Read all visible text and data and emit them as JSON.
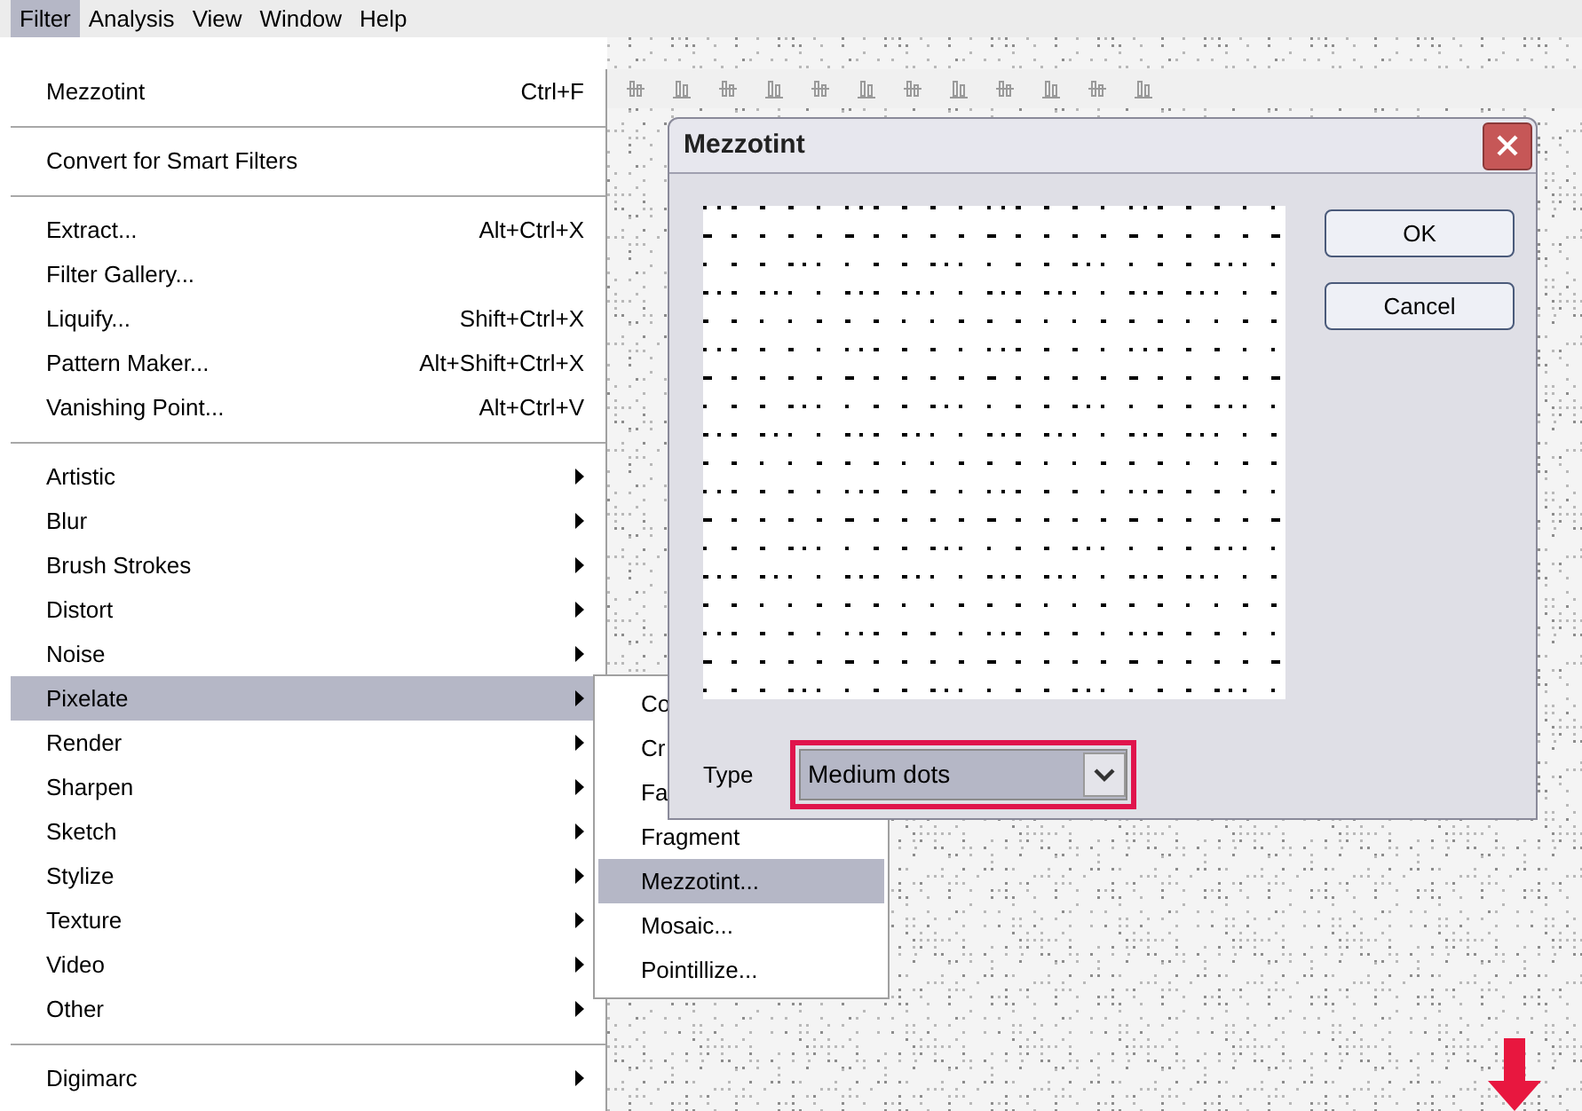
{
  "menu_bar": [
    {
      "label": "Filter",
      "selected": true
    },
    {
      "label": "Analysis",
      "selected": false
    },
    {
      "label": "View",
      "selected": false
    },
    {
      "label": "Window",
      "selected": false
    },
    {
      "label": "Help",
      "selected": false
    }
  ],
  "filter_menu": {
    "items": [
      {
        "kind": "item",
        "label": "Mezzotint",
        "shortcut": "Ctrl+F",
        "selected": false
      },
      {
        "kind": "separator"
      },
      {
        "kind": "item",
        "label": "Convert for Smart Filters",
        "selected": false
      },
      {
        "kind": "separator"
      },
      {
        "kind": "item",
        "label": "Extract...",
        "shortcut": "Alt+Ctrl+X",
        "selected": false
      },
      {
        "kind": "item",
        "label": "Filter Gallery...",
        "selected": false
      },
      {
        "kind": "item",
        "label": "Liquify...",
        "shortcut": "Shift+Ctrl+X",
        "selected": false
      },
      {
        "kind": "item",
        "label": "Pattern Maker...",
        "shortcut": "Alt+Shift+Ctrl+X",
        "selected": false
      },
      {
        "kind": "item",
        "label": "Vanishing Point...",
        "shortcut": "Alt+Ctrl+V",
        "selected": false
      },
      {
        "kind": "separator"
      },
      {
        "kind": "submenu",
        "label": "Artistic",
        "selected": false
      },
      {
        "kind": "submenu",
        "label": "Blur",
        "selected": false
      },
      {
        "kind": "submenu",
        "label": "Brush Strokes",
        "selected": false
      },
      {
        "kind": "submenu",
        "label": "Distort",
        "selected": false
      },
      {
        "kind": "submenu",
        "label": "Noise",
        "selected": false
      },
      {
        "kind": "submenu",
        "label": "Pixelate",
        "selected": true
      },
      {
        "kind": "submenu",
        "label": "Render",
        "selected": false
      },
      {
        "kind": "submenu",
        "label": "Sharpen",
        "selected": false
      },
      {
        "kind": "submenu",
        "label": "Sketch",
        "selected": false
      },
      {
        "kind": "submenu",
        "label": "Stylize",
        "selected": false
      },
      {
        "kind": "submenu",
        "label": "Texture",
        "selected": false
      },
      {
        "kind": "submenu",
        "label": "Video",
        "selected": false
      },
      {
        "kind": "submenu",
        "label": "Other",
        "selected": false
      },
      {
        "kind": "separator"
      },
      {
        "kind": "submenu",
        "label": "Digimarc",
        "selected": false
      }
    ]
  },
  "pixelate_submenu": {
    "items": [
      {
        "label": "Co",
        "selected": false
      },
      {
        "label": "Cr",
        "selected": false
      },
      {
        "label": "Fa",
        "selected": false
      },
      {
        "label": "Fragment",
        "selected": false
      },
      {
        "label": "Mezzotint...",
        "selected": true
      },
      {
        "label": "Mosaic...",
        "selected": false
      },
      {
        "label": "Pointillize...",
        "selected": false
      }
    ]
  },
  "dialog": {
    "title": "Mezzotint",
    "buttons": [
      "OK",
      "Cancel"
    ],
    "type_label": "Type",
    "type_select": {
      "value": "Medium dots",
      "highlighted": true
    }
  }
}
